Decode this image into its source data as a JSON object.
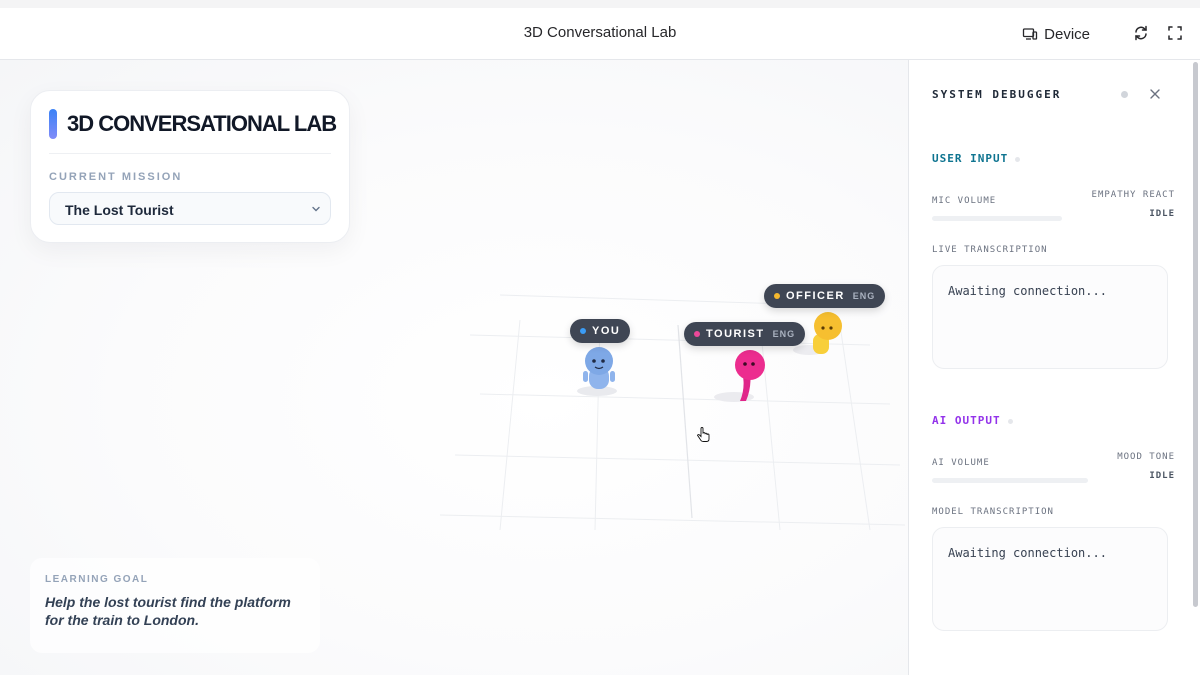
{
  "topbar": {
    "title": "3D Conversational Lab",
    "device_label": "Device",
    "icons": [
      "device-icon",
      "refresh-icon",
      "fullscreen-icon"
    ]
  },
  "mission_card": {
    "title": "3D CONVERSATIONAL LAB",
    "mission_label": "CURRENT MISSION",
    "selected_mission": "The Lost Tourist"
  },
  "learning_goal": {
    "label": "LEARNING GOAL",
    "text": "Help the lost tourist find the platform for the train to London."
  },
  "characters": [
    {
      "name": "YOU",
      "lang": "",
      "dot_color": "#3b9cf5",
      "body_color": "#7ea8e6"
    },
    {
      "name": "TOURIST",
      "lang": "ENG",
      "dot_color": "#ec4899",
      "body_color": "#ec2d8f"
    },
    {
      "name": "OFFICER",
      "lang": "ENG",
      "dot_color": "#f5b82e",
      "body_color": "#f6c230"
    }
  ],
  "debugger": {
    "title": "SYSTEM DEBUGGER",
    "user_input": {
      "heading": "USER INPUT",
      "heading_color": "#0e7490",
      "mic_volume_label": "MIC VOLUME",
      "empathy_label": "EMPATHY REACT",
      "empathy_value": "IDLE",
      "live_label": "LIVE TRANSCRIPTION",
      "live_text": "Awaiting connection..."
    },
    "ai_output": {
      "heading": "AI OUTPUT",
      "heading_color": "#9333ea",
      "ai_volume_label": "AI VOLUME",
      "mood_label": "MOOD TONE",
      "mood_value": "IDLE",
      "model_label": "MODEL TRANSCRIPTION",
      "model_text": "Awaiting connection..."
    }
  }
}
